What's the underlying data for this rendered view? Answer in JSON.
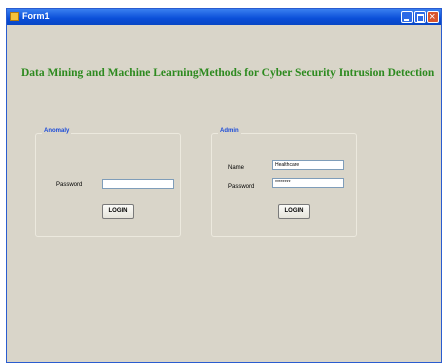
{
  "window": {
    "title": "Form1"
  },
  "header": {
    "title": "Data Mining and Machine LearningMethods for Cyber Security Intrusion Detection"
  },
  "anomaly": {
    "legend": "Anomaly",
    "password_label": "Password",
    "password_value": "",
    "login_label": "LOGIN"
  },
  "admin": {
    "legend": "Admin",
    "name_label": "Name",
    "name_value": "Healthcare",
    "password_label": "Password",
    "password_value": "********",
    "login_label": "LOGIN"
  },
  "colors": {
    "title_green": "#2d8a1f",
    "legend_blue": "#1b4bd8",
    "titlebar_blue": "#0a4ed8",
    "window_bg": "#d9d5c9"
  }
}
